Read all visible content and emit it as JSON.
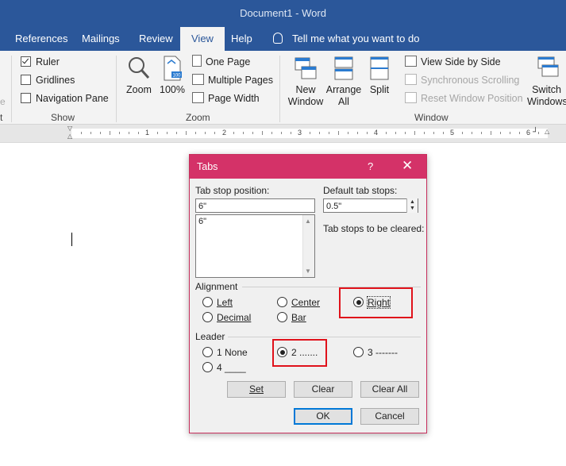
{
  "window": {
    "title": "Document1  -  Word"
  },
  "ribbon_tabs": [
    {
      "label": "References"
    },
    {
      "label": "Mailings"
    },
    {
      "label": "Review"
    },
    {
      "label": "View"
    },
    {
      "label": "Help"
    }
  ],
  "tell_me": "Tell me what you want to do",
  "show_group": {
    "label": "Show",
    "ruler": "Ruler",
    "gridlines": "Gridlines",
    "navigation_pane": "Navigation Pane",
    "ruler_checked": true,
    "gridlines_checked": false,
    "navigation_checked": false
  },
  "zoom_group": {
    "label": "Zoom",
    "zoom": "Zoom",
    "hundred": "100%",
    "hundred_icon": "100",
    "one_page": "One Page",
    "multiple_pages": "Multiple Pages",
    "page_width": "Page Width"
  },
  "window_group": {
    "label": "Window",
    "new_window_1": "New",
    "new_window_2": "Window",
    "arrange_all_1": "Arrange",
    "arrange_all_2": "All",
    "split": "Split",
    "view_side_by_side": "View Side by Side",
    "synchronous_scrolling": "Synchronous Scrolling",
    "reset_window_position": "Reset Window Position",
    "switch_1": "Switch",
    "switch_2": "Windows"
  },
  "partial_left": {
    "a": "e",
    "b": "t"
  },
  "ruler_numbers": [
    "1",
    "2",
    "3",
    "4",
    "5",
    "6"
  ],
  "dialog": {
    "title": "Tabs",
    "help": "?",
    "close": "✕",
    "tab_stop_label": "Tab stop position:",
    "tab_stop_value": "6\"",
    "list_items": [
      "6\""
    ],
    "default_tab_label": "Default tab stops:",
    "default_tab_value": "0.5\"",
    "cleared_label": "Tab stops to be cleared:",
    "alignment_label": "Alignment",
    "alignment": {
      "left": "Left",
      "center": "Center",
      "right": "Right",
      "decimal": "Decimal",
      "bar": "Bar",
      "selected": "right"
    },
    "leader_label": "Leader",
    "leader": {
      "none": "1 None",
      "dots": "2 .......",
      "dashes": "3 -------",
      "line": "4 ____",
      "selected": "2"
    },
    "buttons": {
      "set": "Set",
      "clear": "Clear",
      "clear_all": "Clear All",
      "ok": "OK",
      "cancel": "Cancel"
    }
  }
}
